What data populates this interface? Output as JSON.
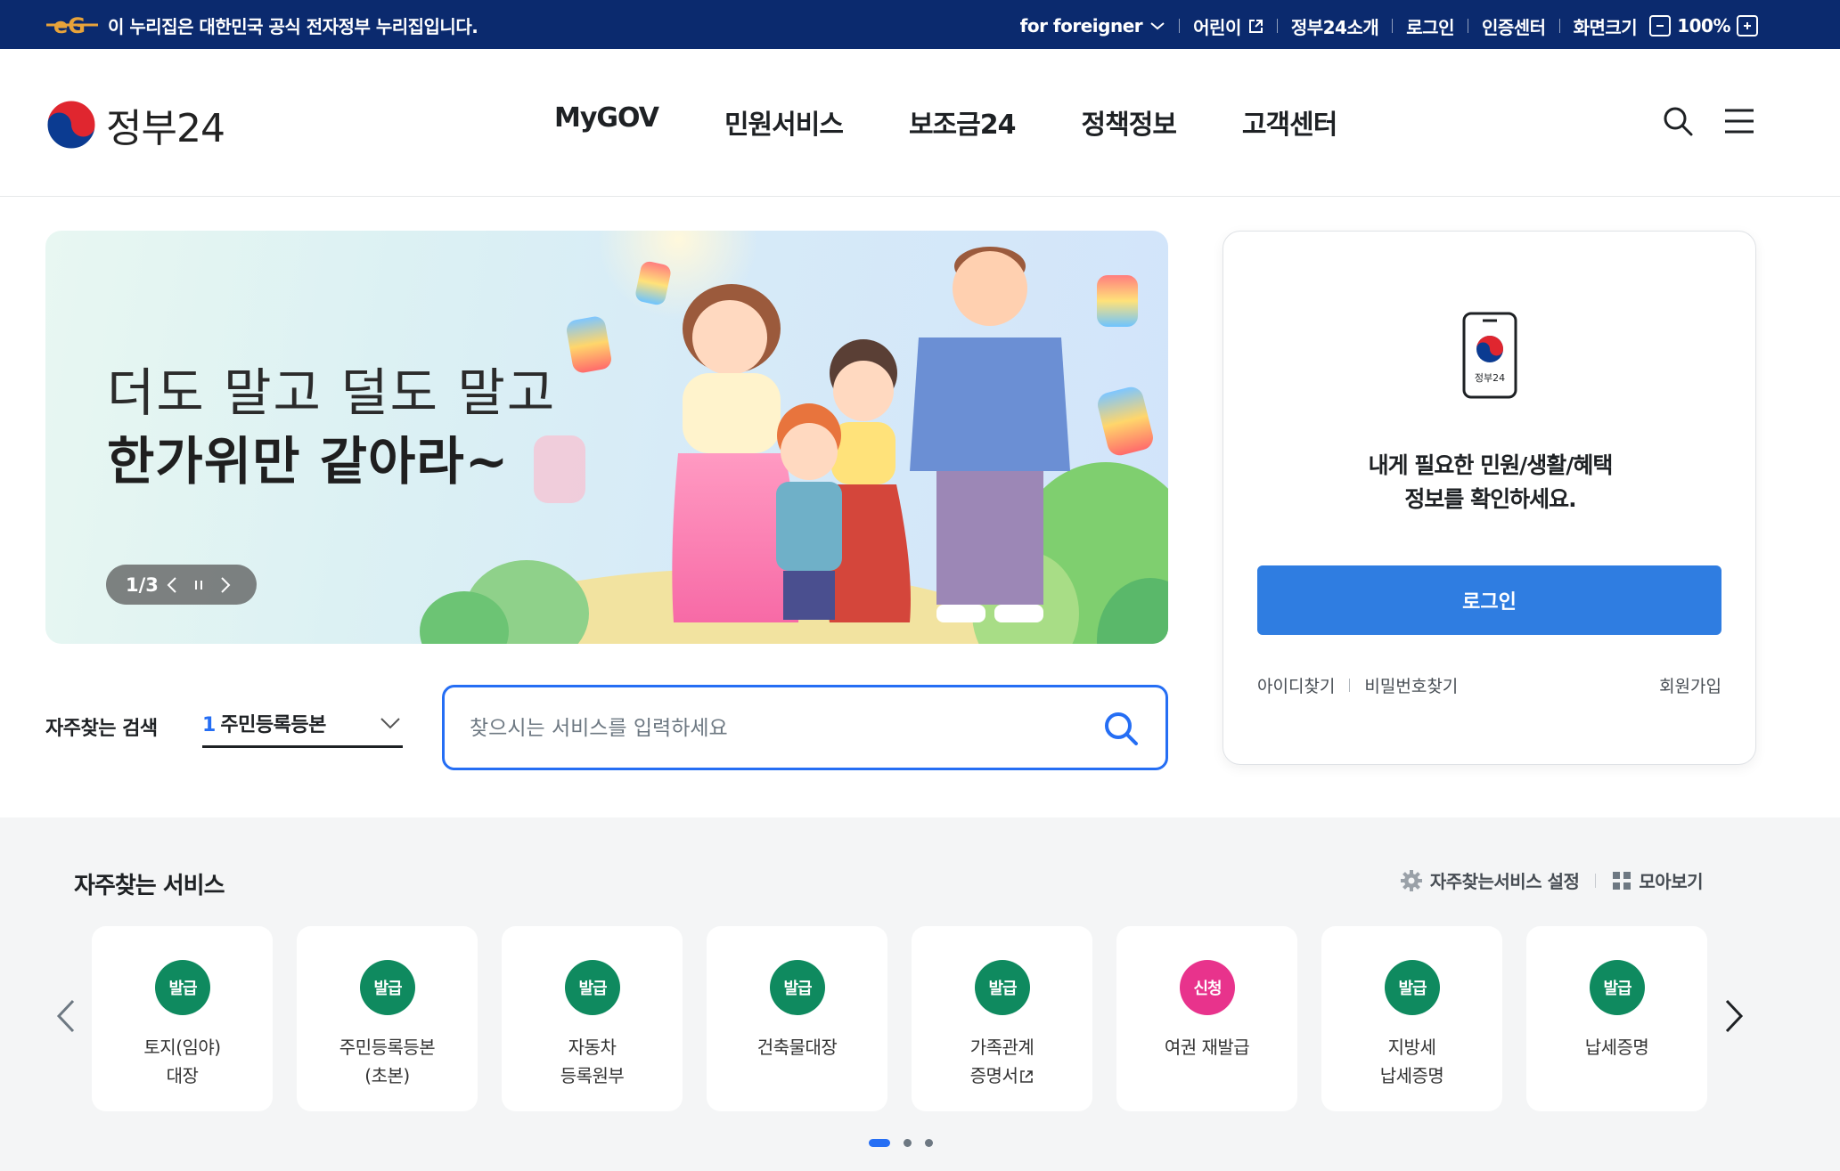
{
  "gov_banner": {
    "text": "이 누리집은 대한민국 공식 전자정부 누리집입니다.",
    "links": [
      {
        "label": "for foreigner"
      },
      {
        "label": "어린이"
      },
      {
        "label": "정부24소개"
      },
      {
        "label": "로그인"
      },
      {
        "label": "인증센터"
      },
      {
        "label": "화면크기"
      }
    ],
    "zoom": "100%"
  },
  "header": {
    "logo_text": "정부24",
    "nav": [
      "MyGOV",
      "민원서비스",
      "보조금24",
      "정책정보",
      "고객센터"
    ]
  },
  "hero": {
    "line1": "더도 말고 덜도 말고",
    "line2": "한가위만 같아라~",
    "pager": "1/3"
  },
  "frequent_search": {
    "label": "자주찾는 검색",
    "rank": "1",
    "selected": "주민등록등본"
  },
  "search": {
    "placeholder": "찾으시는 서비스를 입력하세요"
  },
  "login_card": {
    "app_label": "정부24",
    "message_line1": "내게 필요한 민원/생활/혜택",
    "message_line2": "정보를 확인하세요.",
    "login_button": "로그인",
    "find_id": "아이디찾기",
    "find_pw": "비밀번호찾기",
    "join": "회원가입"
  },
  "services": {
    "title": "자주찾는 서비스",
    "settings_label": "자주찾는서비스 설정",
    "view_all_label": "모아보기",
    "items": [
      {
        "badge": "발급",
        "name": "토지(임야)\n대장"
      },
      {
        "badge": "발급",
        "name": "주민등록등본\n(초본)"
      },
      {
        "badge": "발급",
        "name": "자동차\n등록원부"
      },
      {
        "badge": "발급",
        "name": "건축물대장"
      },
      {
        "badge": "발급",
        "name": "가족관계\n증명서"
      },
      {
        "badge": "신청",
        "name": "여권 재발급"
      },
      {
        "badge": "발급",
        "name": "지방세\n납세증명"
      },
      {
        "badge": "발급",
        "name": "납세증명"
      }
    ]
  },
  "colors": {
    "gov_bar": "#0b2a6e",
    "accent_blue": "#256ef4",
    "login_button": "#2f7de1",
    "badge_issue": "#0f8a5f",
    "badge_apply": "#e8338c"
  }
}
